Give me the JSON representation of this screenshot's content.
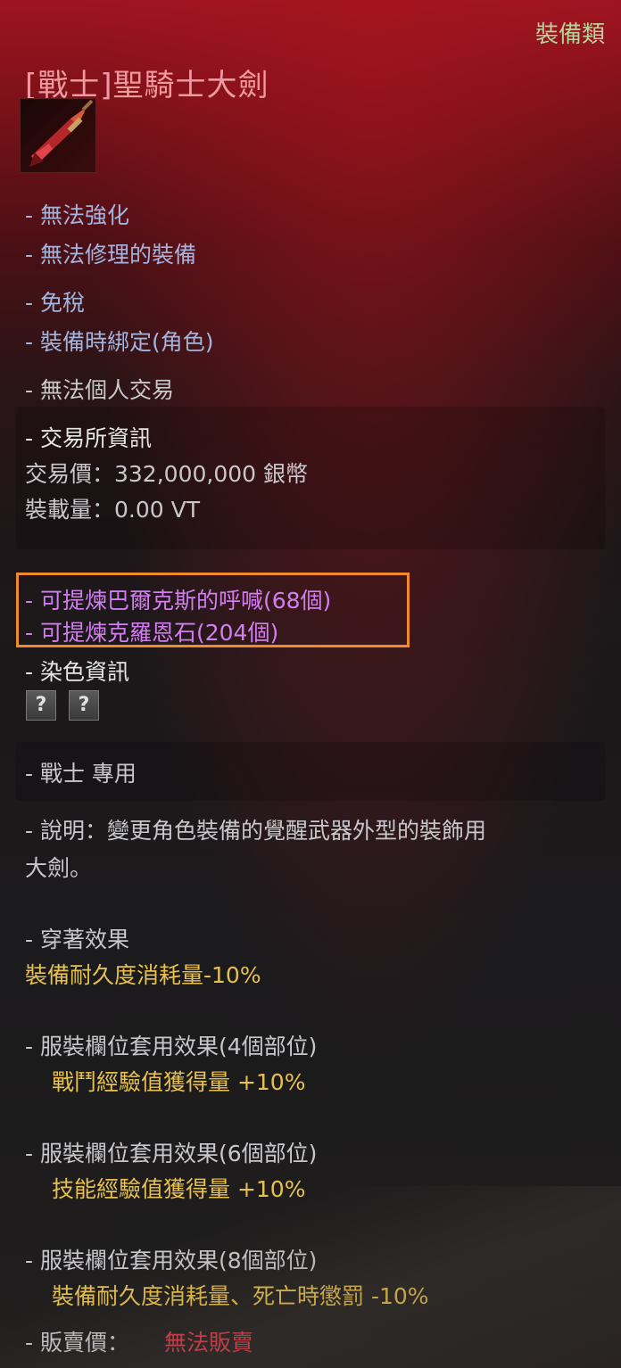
{
  "tooltip": {
    "category": "裝備類",
    "title": "[戰士]聖騎士大劍",
    "icon": "greatsword-icon",
    "properties": [
      "- 無法強化",
      "- 無法修理的裝備",
      "- 免稅",
      "- 裝備時綁定(角色)"
    ],
    "no_trade": "- 無法個人交易",
    "market": {
      "header": "- 交易所資訊",
      "price": "交易價：332,000,000 銀幣",
      "weight": "裝載量：0.00 VT"
    },
    "extract": [
      "- 可提煉巴爾克斯的呼喊(68個)",
      "- 可提煉克羅恩石(204個)"
    ],
    "dye": {
      "header": "- 染色資訊",
      "slots": [
        "?",
        "?"
      ]
    },
    "class_only": "- 戰士 專用",
    "description": {
      "line1": "- 說明：變更角色裝備的覺醒武器外型的裝飾用",
      "line2": "大劍。"
    },
    "wear_effect": {
      "header": "- 穿著效果",
      "value": "裝備耐久度消耗量-10%"
    },
    "set_effects": [
      {
        "header": "- 服裝欄位套用效果(4個部位)",
        "value": "戰鬥經驗值獲得量 +10%"
      },
      {
        "header": "- 服裝欄位套用效果(6個部位)",
        "value": "技能經驗值獲得量 +10%"
      },
      {
        "header": "- 服裝欄位套用效果(8個部位)",
        "value": "裝備耐久度消耗量、死亡時懲罰 -10%"
      }
    ],
    "sell": {
      "label": "- 販賣價：",
      "value": "無法販賣"
    }
  },
  "colors": {
    "property": "#a3b4df",
    "extract": "#d27ef0",
    "effect": "#e7c04d",
    "highlight": "#f08a2a",
    "sell_value": "#d83a4a"
  }
}
